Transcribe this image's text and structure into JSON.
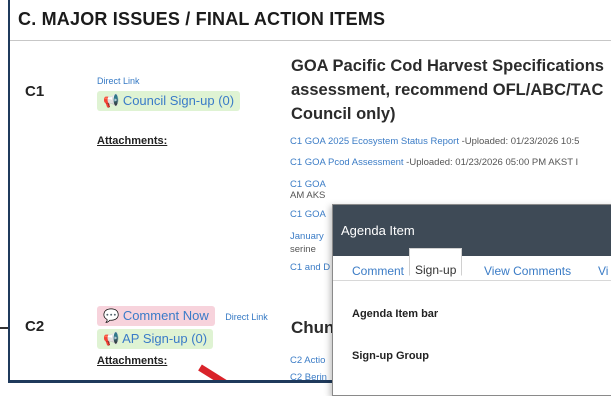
{
  "section": {
    "title": "C. MAJOR ISSUES / FINAL ACTION ITEMS"
  },
  "c1": {
    "id": "C1",
    "direct_link": "Direct Link",
    "signup_button": "Council Sign-up (0)",
    "attachments_label": "Attachments:",
    "title_lines": [
      "GOA Pacific Cod Harvest Specifications",
      "assessment, recommend OFL/ABC/TAC",
      "Council only)"
    ],
    "attachments": [
      {
        "link": "C1 GOA 2025 Ecosystem Status Report",
        "meta": " -Uploaded: 01/23/2026 10:5"
      },
      {
        "link": "C1 GOA Pcod Assessment",
        "meta": " -Uploaded: 01/23/2026 05:00 PM AKST I"
      },
      {
        "link": "C1 GOA",
        "meta": ""
      },
      {
        "link": "",
        "meta": "AM AKS"
      },
      {
        "link": "C1 GOA",
        "meta": ""
      },
      {
        "link": "January",
        "meta": ""
      },
      {
        "link": "",
        "meta": "serine"
      },
      {
        "link": "C1 and D",
        "meta": ""
      }
    ]
  },
  "c2": {
    "id": "C2",
    "comment_button": "Comment Now",
    "direct_link": "Direct Link",
    "signup_button": "AP Sign-up (0)",
    "attachments_label": "Attachments:",
    "title": "Chun",
    "attachments": [
      "C2 Actio",
      "C2 Berin"
    ]
  },
  "modal": {
    "title": "Agenda Item",
    "tabs": [
      "Comment",
      "Sign-up",
      "View Comments",
      "Vi"
    ],
    "active_tab": "Sign-up",
    "fields": [
      "Agenda Item bar",
      "Sign-up Group"
    ]
  },
  "colors": {
    "accent_link": "#3b7cc6",
    "green_pill": "#dff3d3",
    "pink_pill": "#f7d3dc",
    "modal_header": "#3e4a56",
    "arrow": "#d9232a"
  }
}
